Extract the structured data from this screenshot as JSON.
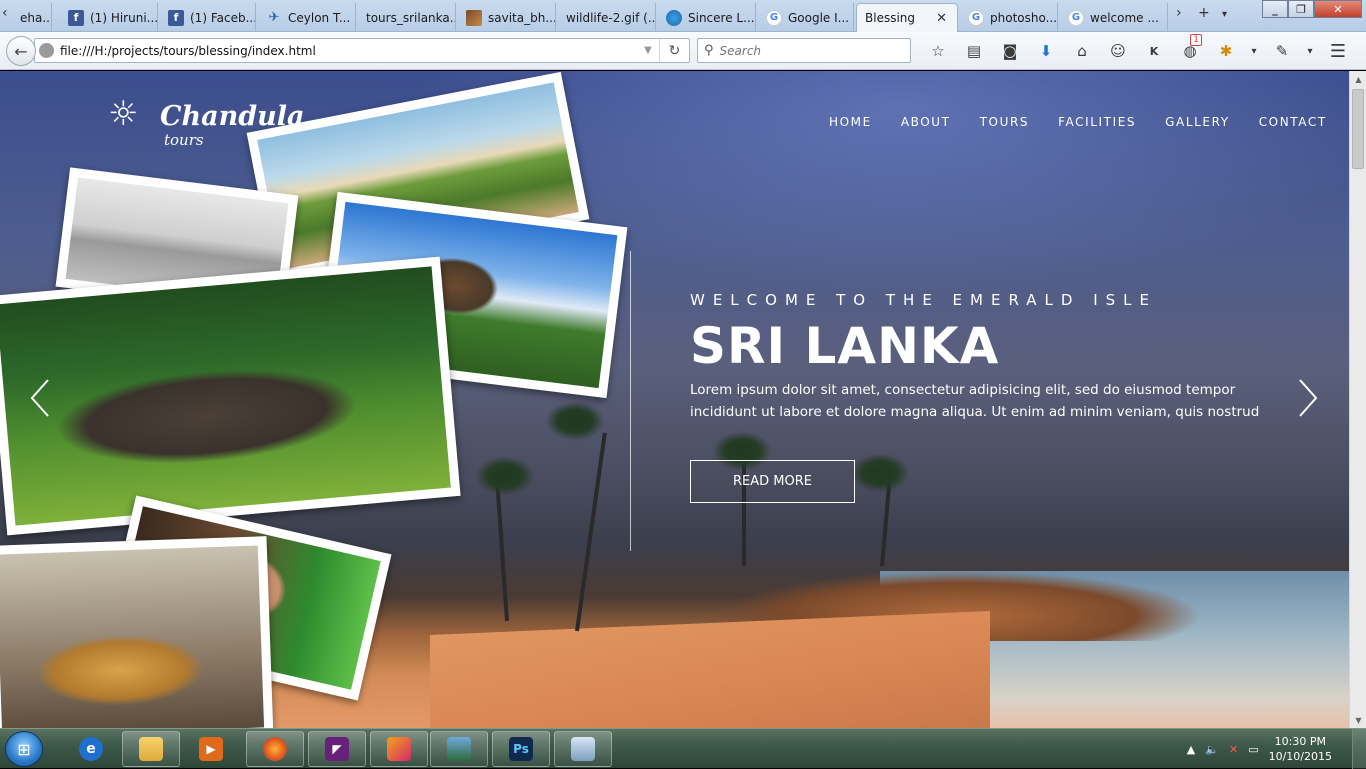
{
  "browser": {
    "tabs": [
      {
        "label": "eha...",
        "icon": "blank-icon"
      },
      {
        "label": "(1) Hiruni...",
        "icon": "facebook-icon"
      },
      {
        "label": "(1) Faceb...",
        "icon": "facebook-icon"
      },
      {
        "label": "Ceylon T...",
        "icon": "ceylon-icon"
      },
      {
        "label": "tours_srilanka...",
        "icon": "blank-icon"
      },
      {
        "label": "savita_bh...",
        "icon": "image-icon"
      },
      {
        "label": "wildlife-2.gif (...",
        "icon": "blank-icon"
      },
      {
        "label": "Sincere L...",
        "icon": "sincere-icon"
      },
      {
        "label": "Google I...",
        "icon": "google-icon"
      },
      {
        "label": "Blessing",
        "icon": "blank-icon"
      },
      {
        "label": "photosho...",
        "icon": "google-icon"
      },
      {
        "label": "welcome ...",
        "icon": "google-icon"
      }
    ],
    "active_tab": "Blessing",
    "url": "file:///H:/projects/tours/blessing/index.html",
    "search_placeholder": "Search",
    "badge_count": "1"
  },
  "site": {
    "logo": {
      "name": "Chandula",
      "sub": "tours"
    },
    "nav": [
      "HOME",
      "ABOUT",
      "TOURS",
      "FACILITIES",
      "GALLERY",
      "CONTACT"
    ],
    "hero": {
      "kicker": "WELCOME TO THE EMERALD ISLE",
      "title": "SRI LANKA",
      "lead": "Lorem ipsum dolor sit amet, consectetur adipisicing elit, sed do eiusmod tempor incididunt ut labore et dolore magna aliqua. Ut enim ad minim veniam, quis nostrud",
      "button": "READ MORE"
    },
    "photos": [
      "beach-couple-photo",
      "beach-resort-photo",
      "sigiriya-rock-photo",
      "elephants-photo",
      "spa-woman-photo",
      "leopard-photo"
    ]
  },
  "taskbar": {
    "apps": [
      "internet-explorer-icon",
      "file-explorer-icon",
      "media-player-icon",
      "firefox-icon",
      "visual-studio-icon",
      "app-icon",
      "photo-viewer-icon",
      "photoshop-icon",
      "remote-desktop-icon"
    ],
    "photoshop_label": "Ps",
    "time": "10:30 PM",
    "date": "10/10/2015"
  },
  "colors": {
    "tab_bar": "#c9dbee",
    "taskbar": "#3e5a4a",
    "facebook": "#3b5998",
    "photoshop": "#0f2a4e"
  }
}
